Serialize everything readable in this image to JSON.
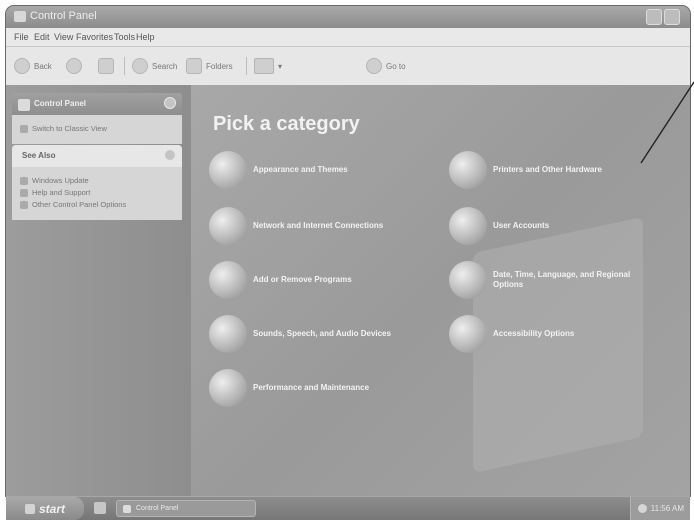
{
  "window": {
    "title": "Control Panel",
    "icon": "control-panel-icon"
  },
  "menu": [
    "File",
    "Edit",
    "View",
    "Favorites",
    "Tools",
    "Help"
  ],
  "toolbar": {
    "back": "Back",
    "forward_icon": "forward-arrow-icon",
    "up_icon": "up-folder-icon",
    "search": "Search",
    "folders": "Folders",
    "views_icon": "views-icon",
    "go_to": "Go to"
  },
  "sidebar": {
    "control_panel": {
      "title": "Control Panel",
      "switch_link": "Switch to Classic View"
    },
    "see_also": {
      "title": "See Also",
      "items": [
        "Windows Update",
        "Help and Support",
        "Other Control Panel Options"
      ]
    }
  },
  "main": {
    "heading": "Pick a category",
    "categories": [
      {
        "label": "Appearance and Themes",
        "icon": "appearance-themes-icon"
      },
      {
        "label": "Printers and Other Hardware",
        "icon": "printers-hardware-icon"
      },
      {
        "label": "Network and Internet Connections",
        "icon": "network-globe-icon"
      },
      {
        "label": "User Accounts",
        "icon": "user-accounts-icon"
      },
      {
        "label": "Add or Remove Programs",
        "icon": "add-remove-programs-icon"
      },
      {
        "label": "Date, Time, Language, and Regional Options",
        "icon": "date-time-region-icon"
      },
      {
        "label": "Sounds, Speech, and Audio Devices",
        "icon": "sounds-audio-icon"
      },
      {
        "label": "Accessibility Options",
        "icon": "accessibility-icon"
      },
      {
        "label": "Performance and Maintenance",
        "icon": "performance-maintenance-icon"
      }
    ]
  },
  "taskbar": {
    "start": "start",
    "task": "Control Panel",
    "clock": "11:56 AM"
  }
}
